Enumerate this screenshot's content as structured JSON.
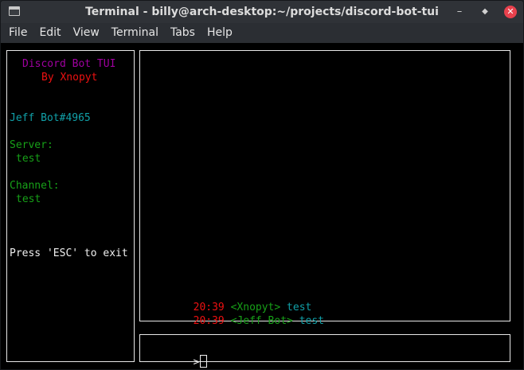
{
  "window": {
    "title": "Terminal - billy@arch-desktop:~/projects/discord-bot-tui",
    "controls": {
      "minimize": "–",
      "maximize": "◆",
      "close": "✕"
    }
  },
  "menu": [
    "File",
    "Edit",
    "View",
    "Terminal",
    "Tabs",
    "Help"
  ],
  "sidebar": {
    "app_title": "Discord Bot TUI",
    "author": "By Xnopyt",
    "bot_name": "Jeff Bot#4965",
    "server_label": "Server:",
    "server_value": "test",
    "channel_label": "Channel:",
    "channel_value": "test",
    "exit_hint": "Press 'ESC' to exit"
  },
  "messages": [
    {
      "time": "20:39",
      "author": "<Xnopyt>",
      "text": "test"
    },
    {
      "time": "20:39",
      "author": "<Jeff Bot>",
      "text": "test"
    }
  ],
  "input": {
    "prompt": ">",
    "value": ""
  },
  "colors": {
    "title": "#a000a0",
    "author_line": "#ee1111",
    "bot_name": "#11a0a8",
    "labels": "#17a018",
    "timestamp": "#ee1111",
    "message_text": "#11a0a8"
  }
}
